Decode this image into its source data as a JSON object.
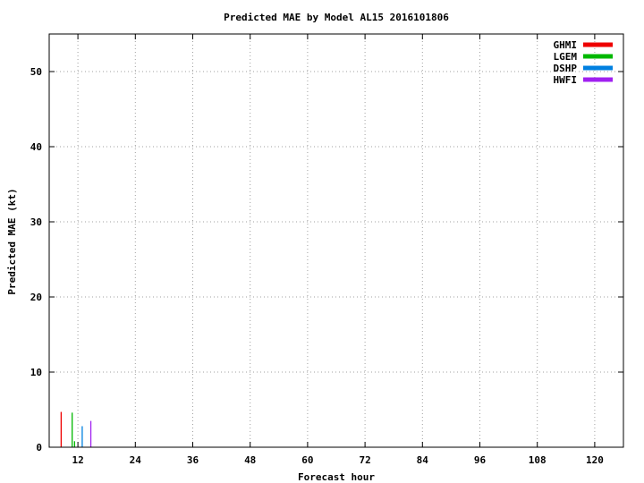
{
  "chart_data": {
    "type": "bar",
    "title": "Predicted MAE by Model  AL15 2016101806",
    "xlabel": "Forecast hour",
    "ylabel": "Predicted MAE (kt)",
    "xlim": [
      6,
      126
    ],
    "ylim": [
      0,
      55
    ],
    "xticks": [
      12,
      24,
      36,
      48,
      60,
      72,
      84,
      96,
      108,
      120
    ],
    "yticks": [
      0,
      10,
      20,
      30,
      40,
      50
    ],
    "grid": true,
    "legend_position": "top-right",
    "categories": [
      12
    ],
    "series": [
      {
        "name": "GHMI",
        "color": "#ee0000",
        "values": [
          4.7
        ]
      },
      {
        "name": "LGEM",
        "color": "#00b800",
        "values": [
          4.6
        ]
      },
      {
        "name": "DSHP",
        "color": "#0080e0",
        "values": [
          2.8
        ]
      },
      {
        "name": "HWFI",
        "color": "#a020f0",
        "values": [
          3.5
        ]
      }
    ],
    "extra_bars": [
      {
        "series": "LGEM",
        "x": 11.3,
        "value": 0.8
      }
    ]
  }
}
